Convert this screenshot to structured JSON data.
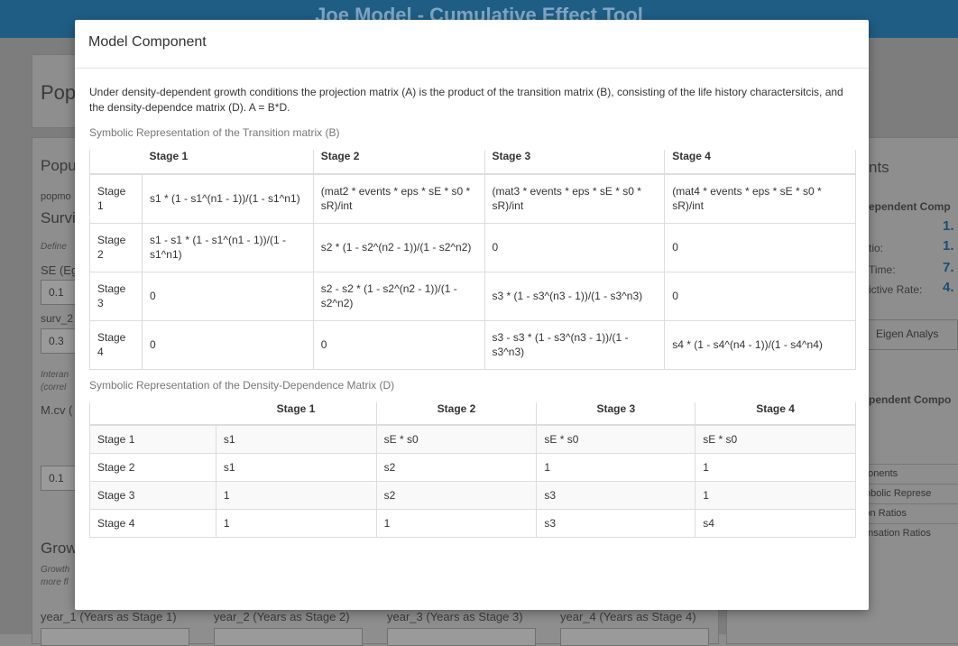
{
  "app": {
    "title": "Joe Model - Cumulative Effect Tool"
  },
  "background": {
    "heading": "Pop",
    "section": "Popu",
    "popmod_label": "popmo",
    "surv_label": "Survi",
    "define_label": "Define",
    "se_label": "SE (Eg",
    "se_value": "0.1",
    "surv2_label": "surv_2",
    "surv2_value": "0.3",
    "interan_label": "Interan",
    "correl_label": "(correl",
    "mcv_label": "M.cv (",
    "mcv_value": "0.1",
    "grow_label": "Grow",
    "growth_small": "Growth",
    "more_small": "more fl",
    "year_labels": [
      "year_1 (Years as Stage 1)",
      "year_2 (Years as Stage 2)",
      "year_3 (Years as Stage 3)",
      "year_4 (Years as Stage 4)"
    ],
    "right": {
      "heading": "nts",
      "dependent_comp": "ependent Comp",
      "v1": "1.",
      "ratio_label": "tio:",
      "v2": "1.",
      "time_label": "Time:",
      "v3": "7.",
      "active_label": "ictive Rate:",
      "v4": "4.",
      "eigen_button": "Eigen Analys",
      "dependent_compo": "pendent Compo",
      "rows": [
        "ponents",
        "mbolic Represe",
        "ion Ratios",
        "ensation Ratios"
      ]
    }
  },
  "modal": {
    "title": "Model Component",
    "intro": "Under density-dependent growth conditions the projection matrix (A) is the product of the transition matrix (B), consisting of the life history charactersitcis, and the density-dependce matrix (D). A = B*D.",
    "transition": {
      "caption": "Symbolic Representation of the Transition matrix (B)",
      "headers": [
        "",
        "Stage 1",
        "Stage 2",
        "Stage 3",
        "Stage 4"
      ],
      "rows": [
        [
          "Stage 1",
          "s1 * (1 - s1^(n1 - 1))/(1 - s1^n1)",
          "(mat2 * events * eps * sE * s0 * sR)/int",
          "(mat3 * events * eps * sE * s0 * sR)/int",
          "(mat4 * events * eps * sE * s0 * sR)/int"
        ],
        [
          "Stage 2",
          "s1 - s1 * (1 - s1^(n1 - 1))/(1 - s1^n1)",
          "s2 * (1 - s2^(n2 - 1))/(1 - s2^n2)",
          "0",
          "0"
        ],
        [
          "Stage 3",
          "0",
          "s2 - s2 * (1 - s2^(n2 - 1))/(1 - s2^n2)",
          "s3 * (1 - s3^(n3 - 1))/(1 - s3^n3)",
          "0"
        ],
        [
          "Stage 4",
          "0",
          "0",
          "s3 - s3 * (1 - s3^(n3 - 1))/(1 - s3^n3)",
          "s4 * (1 - s4^(n4 - 1))/(1 - s4^n4)"
        ]
      ]
    },
    "density": {
      "caption": "Symbolic Representation of the Density-Dependence Matrix (D)",
      "headers": [
        "",
        "Stage 1",
        "Stage 2",
        "Stage 3",
        "Stage 4"
      ],
      "rows": [
        [
          "Stage 1",
          "s1",
          "sE * s0",
          "sE * s0",
          "sE * s0"
        ],
        [
          "Stage 2",
          "s1",
          "s2",
          "1",
          "1"
        ],
        [
          "Stage 3",
          "1",
          "s2",
          "s3",
          "1"
        ],
        [
          "Stage 4",
          "1",
          "1",
          "s3",
          "s4"
        ]
      ]
    }
  }
}
